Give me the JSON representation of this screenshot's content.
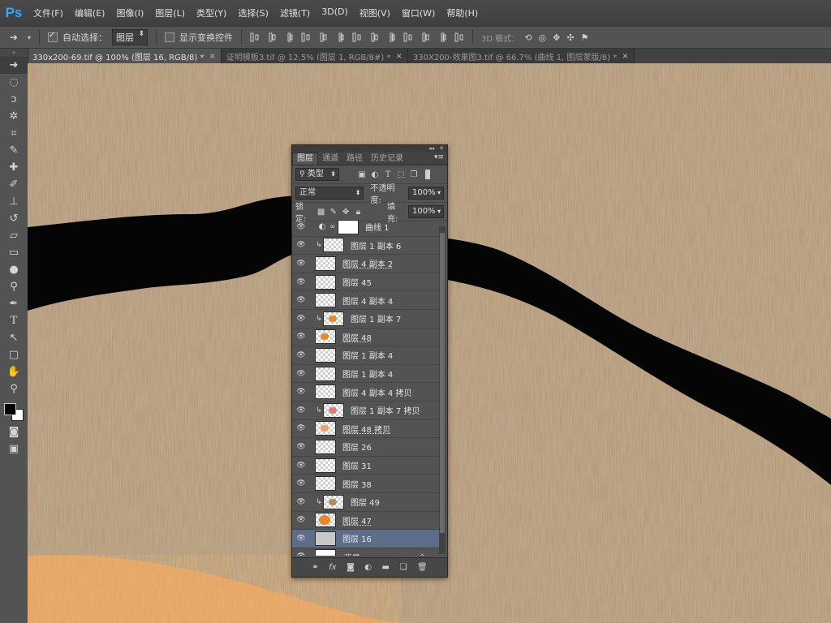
{
  "app": {
    "logo": "Ps",
    "menus": [
      "文件(F)",
      "编辑(E)",
      "图像(I)",
      "图层(L)",
      "类型(Y)",
      "选择(S)",
      "滤镜(T)",
      "3D(D)",
      "视图(V)",
      "窗口(W)",
      "帮助(H)"
    ]
  },
  "options": {
    "auto_select_label": "自动选择：",
    "auto_select_target": "图层",
    "show_transform_label": "显示变换控件",
    "mode_3d_label": "3D 模式："
  },
  "tabs": [
    {
      "label": "330x200-69.tif @ 100% (图层 16, RGB/8) *",
      "active": true
    },
    {
      "label": "证明模板3.tif @ 12.5% (图层 1, RGB/8#) *",
      "active": false
    },
    {
      "label": "330X200-效果图3.tif @ 66.7% (曲线 1, 图层蒙版/8) *",
      "active": false
    }
  ],
  "colors": {
    "bg_dark": "#535353",
    "selected_layer": "#5d6d8a",
    "accent_ps": "#31a8ff",
    "orange": "#e8882c"
  },
  "layers_panel": {
    "tabs": [
      "图层",
      "通道",
      "路径",
      "历史记录"
    ],
    "filter_label": "类型",
    "blend_mode": "正常",
    "opacity_label": "不透明度:",
    "opacity_value": "100%",
    "lock_label": "锁定:",
    "fill_label": "填充:",
    "fill_value": "100%",
    "layers": [
      {
        "name": "曲线 1",
        "type": "adjustment",
        "clipped": false,
        "selected": false,
        "underline": false,
        "thumb": "white"
      },
      {
        "name": "图层 1 副本 6",
        "type": "layer",
        "clipped": true,
        "selected": false,
        "underline": false,
        "thumb": "checker"
      },
      {
        "name": "图层 4 副本 2",
        "type": "layer",
        "clipped": false,
        "selected": false,
        "underline": true,
        "thumb": "checker"
      },
      {
        "name": "图层 45",
        "type": "layer",
        "clipped": false,
        "selected": false,
        "underline": false,
        "thumb": "checker"
      },
      {
        "name": "图层 4 副本 4",
        "type": "layer",
        "clipped": false,
        "selected": false,
        "underline": false,
        "thumb": "checker"
      },
      {
        "name": "图层 1 副本 7",
        "type": "layer",
        "clipped": true,
        "selected": false,
        "underline": false,
        "thumb": "orange"
      },
      {
        "name": "图层 48",
        "type": "layer",
        "clipped": false,
        "selected": false,
        "underline": true,
        "thumb": "orange"
      },
      {
        "name": "图层 1 副本 4",
        "type": "layer",
        "clipped": false,
        "selected": false,
        "underline": false,
        "thumb": "checker"
      },
      {
        "name": "图层 1 副本 4",
        "type": "layer",
        "clipped": false,
        "selected": false,
        "underline": false,
        "thumb": "checker"
      },
      {
        "name": "图层 4 副本 4 拷贝",
        "type": "layer",
        "clipped": false,
        "selected": false,
        "underline": false,
        "thumb": "checker"
      },
      {
        "name": "图层 1 副本 7 拷贝",
        "type": "layer",
        "clipped": true,
        "selected": false,
        "underline": false,
        "thumb": "pink"
      },
      {
        "name": "图层 48 拷贝",
        "type": "layer",
        "clipped": false,
        "selected": false,
        "underline": true,
        "thumb": "orange-small"
      },
      {
        "name": "图层 26",
        "type": "layer",
        "clipped": false,
        "selected": false,
        "underline": false,
        "thumb": "checker"
      },
      {
        "name": "图层 31",
        "type": "layer",
        "clipped": false,
        "selected": false,
        "underline": false,
        "thumb": "checker"
      },
      {
        "name": "图层 38",
        "type": "layer",
        "clipped": false,
        "selected": false,
        "underline": false,
        "thumb": "checker"
      },
      {
        "name": "图层 49",
        "type": "layer",
        "clipped": true,
        "selected": false,
        "underline": false,
        "thumb": "tan"
      },
      {
        "name": "图层 47",
        "type": "layer",
        "clipped": false,
        "selected": false,
        "underline": true,
        "thumb": "orange-big"
      },
      {
        "name": "图层 16",
        "type": "layer",
        "clipped": false,
        "selected": true,
        "underline": false,
        "thumb": "gray"
      },
      {
        "name": "背景",
        "type": "background",
        "clipped": false,
        "selected": false,
        "underline": false,
        "thumb": "white"
      }
    ],
    "bottom_icons": [
      "link-icon",
      "fx-icon",
      "mask-icon",
      "adjustment-icon",
      "folder-icon",
      "new-layer-icon",
      "trash-icon"
    ]
  }
}
